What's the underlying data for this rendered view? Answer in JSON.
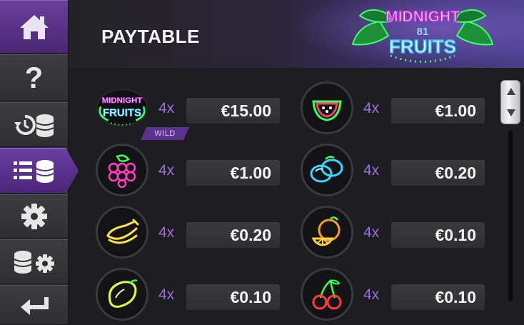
{
  "header": {
    "title": "PAYTABLE"
  },
  "logo": {
    "line1": "MIDNIGHT",
    "line2": "81",
    "line3": "FRUITS"
  },
  "sidebar": {
    "items": [
      {
        "name": "home",
        "icon": "home-icon"
      },
      {
        "name": "help",
        "icon": "question-mark-icon",
        "label": "?"
      },
      {
        "name": "history",
        "icon": "history-coins-icon"
      },
      {
        "name": "paytable",
        "icon": "paytable-list-coins-icon",
        "active": true
      },
      {
        "name": "settings",
        "icon": "gear-icon"
      },
      {
        "name": "bet-settings",
        "icon": "coins-gear-icon"
      },
      {
        "name": "back",
        "icon": "return-arrow-icon"
      }
    ]
  },
  "paytable": {
    "rows": [
      {
        "symbol": "midnight-fruits-wild-icon",
        "logo_top": "MIDNIGHT",
        "logo_bottom": "FRUITS",
        "multiplier": "4x",
        "payout": "€15.00",
        "badge": "WILD"
      },
      {
        "symbol": "watermelon-icon",
        "multiplier": "4x",
        "payout": "€1.00"
      },
      {
        "symbol": "grapes-icon",
        "multiplier": "4x",
        "payout": "€1.00"
      },
      {
        "symbol": "plum-icon",
        "multiplier": "4x",
        "payout": "€0.20"
      },
      {
        "symbol": "banana-icon",
        "multiplier": "4x",
        "payout": "€0.20"
      },
      {
        "symbol": "orange-icon",
        "multiplier": "4x",
        "payout": "€0.10"
      },
      {
        "symbol": "lemon-icon",
        "multiplier": "4x",
        "payout": "€0.10"
      },
      {
        "symbol": "cherry-icon",
        "multiplier": "4x",
        "payout": "€0.10"
      }
    ]
  },
  "colors": {
    "accent_purple": "#6b3ea3",
    "multiplier_purple": "#9a6ee0",
    "neon_green": "#39ff5a",
    "neon_pink": "#ff3fbf",
    "neon_cyan": "#37d7ff",
    "neon_yellow": "#ffe53a",
    "neon_red": "#ff3a3a"
  }
}
